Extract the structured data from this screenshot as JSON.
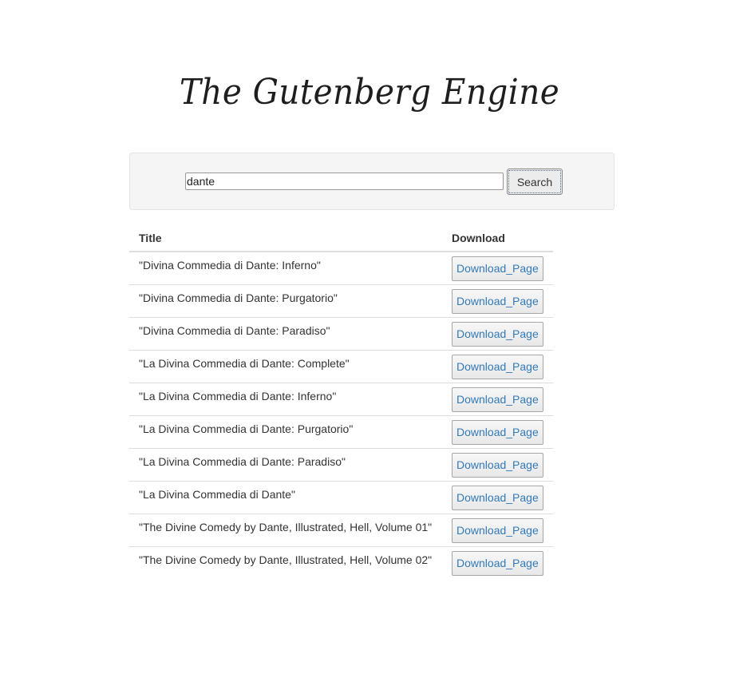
{
  "header": {
    "logo_text": "The Gutenberg Engine"
  },
  "search": {
    "value": "dante",
    "button_label": "Search"
  },
  "results": {
    "columns": [
      "Title",
      "Download"
    ],
    "rows": [
      {
        "title": "\"Divina Commedia di Dante: Inferno\"",
        "download_label": "Download_Page"
      },
      {
        "title": "\"Divina Commedia di Dante: Purgatorio\"",
        "download_label": "Download_Page"
      },
      {
        "title": "\"Divina Commedia di Dante: Paradiso\"",
        "download_label": "Download_Page"
      },
      {
        "title": "\"La Divina Commedia di Dante: Complete\"",
        "download_label": "Download_Page"
      },
      {
        "title": "\"La Divina Commedia di Dante: Inferno\"",
        "download_label": "Download_Page"
      },
      {
        "title": "\"La Divina Commedia di Dante: Purgatorio\"",
        "download_label": "Download_Page"
      },
      {
        "title": "\"La Divina Commedia di Dante: Paradiso\"",
        "download_label": "Download_Page"
      },
      {
        "title": "\"La Divina Commedia di Dante\"",
        "download_label": "Download_Page"
      },
      {
        "title": "\"The Divine Comedy by Dante, Illustrated, Hell, Volume 01\"",
        "download_label": "Download_Page"
      },
      {
        "title": "\"The Divine Comedy by Dante, Illustrated, Hell, Volume 02\"",
        "download_label": "Download_Page"
      }
    ]
  },
  "colors": {
    "link": "#337ab7",
    "well_background": "#f5f5f5",
    "row_border": "#dddddd"
  }
}
